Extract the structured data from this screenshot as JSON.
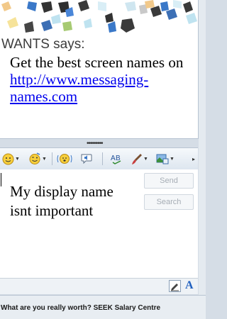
{
  "history": {
    "sender_line": "WANTS says:",
    "message_text": "Get the best screen names on ",
    "message_link": "http://www.messaging-names.com"
  },
  "compose": {
    "text": "My display name isnt important",
    "send_label": "Send",
    "search_label": "Search"
  },
  "toolbar": {
    "icons": [
      "emoticon-icon",
      "wink-icon",
      "nudge-icon",
      "voice-clip-icon",
      "spell-check-icon",
      "ink-brush-icon",
      "background-icon"
    ]
  },
  "banner": {
    "text": "What are you really worth? SEEK Salary Centre"
  },
  "colors": {
    "link": "#0000ee",
    "accent": "#1f5fbf"
  }
}
